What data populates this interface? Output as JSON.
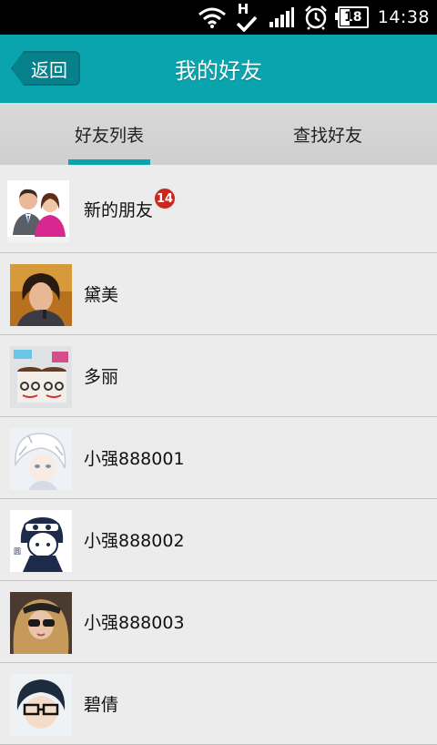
{
  "status_bar": {
    "network_type": "H",
    "battery_level": "18",
    "time": "14:38",
    "icons": [
      "wifi-icon",
      "network-h-icon",
      "signal-icon",
      "alarm-icon",
      "battery-icon"
    ]
  },
  "header": {
    "back_label": "返回",
    "title": "我的好友"
  },
  "tabs": [
    {
      "label": "好友列表",
      "active": true
    },
    {
      "label": "查找好友",
      "active": false
    }
  ],
  "friends": [
    {
      "name": "新的朋友",
      "badge": "14",
      "avatar": "new-friends-avatar"
    },
    {
      "name": "黛美",
      "avatar": "user-avatar"
    },
    {
      "name": "多丽",
      "avatar": "user-avatar"
    },
    {
      "name": "小强888001",
      "avatar": "user-avatar"
    },
    {
      "name": "小强888002",
      "avatar": "user-avatar"
    },
    {
      "name": "小强888003",
      "avatar": "user-avatar"
    },
    {
      "name": "碧倩",
      "avatar": "user-avatar"
    }
  ],
  "colors": {
    "accent": "#0aa4ae",
    "back_button": "#06818c",
    "badge": "#c8281e"
  }
}
